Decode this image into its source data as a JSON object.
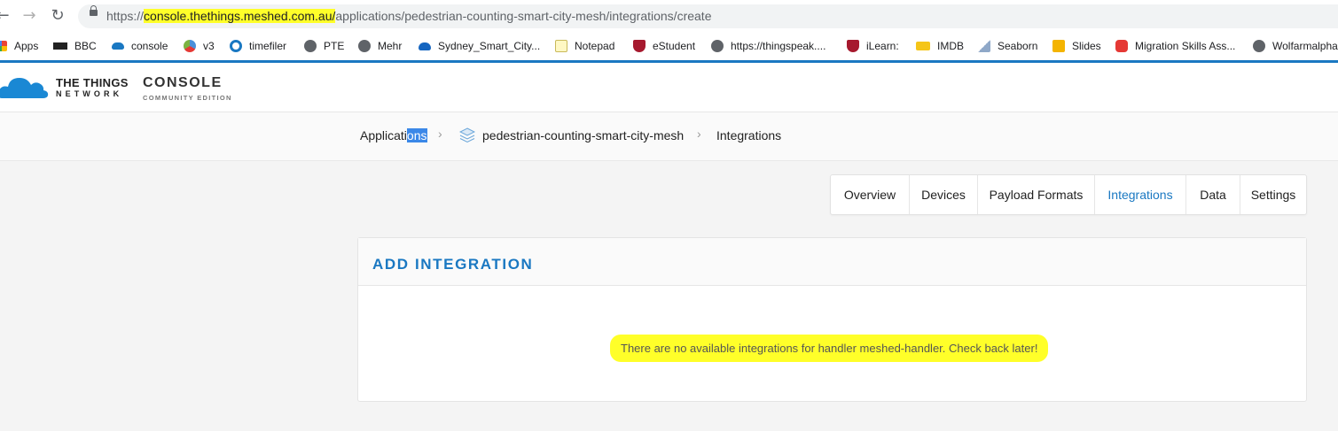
{
  "browser": {
    "url_domain": "console.thethings.meshed.com.au/",
    "url_prefix": "https://",
    "url_path": "applications/pedestrian-counting-smart-city-mesh/integrations/create"
  },
  "bookmarks": [
    {
      "label": "Apps"
    },
    {
      "label": "BBC"
    },
    {
      "label": "console"
    },
    {
      "label": "v3"
    },
    {
      "label": "timefiler"
    },
    {
      "label": "PTE"
    },
    {
      "label": "Mehr"
    },
    {
      "label": "Sydney_Smart_City..."
    },
    {
      "label": "Notepad"
    },
    {
      "label": "eStudent"
    },
    {
      "label": "https://thingspeak...."
    },
    {
      "label": "iLearn:"
    },
    {
      "label": "IMDB"
    },
    {
      "label": "Seaborn"
    },
    {
      "label": "Slides"
    },
    {
      "label": "Migration Skills Ass..."
    },
    {
      "label": "Wolfarmalpha"
    }
  ],
  "header": {
    "logo_line1": "THE THINGS",
    "logo_line2": "NETWORK",
    "console": "CONSOLE",
    "edition": "COMMUNITY EDITION"
  },
  "breadcrumb": {
    "applications_a": "Applicati",
    "applications_b": "ons",
    "app_name": "pedestrian-counting-smart-city-mesh",
    "current": "Integrations"
  },
  "tabs": [
    {
      "label": "Overview"
    },
    {
      "label": "Devices"
    },
    {
      "label": "Payload Formats"
    },
    {
      "label": "Integrations",
      "active": true
    },
    {
      "label": "Data"
    },
    {
      "label": "Settings"
    }
  ],
  "card": {
    "title": "ADD INTEGRATION",
    "message": "There are no available integrations for handler meshed-handler. Check back later!"
  },
  "colors": {
    "accent": "#1a78c2",
    "highlight": "#ffff29"
  }
}
